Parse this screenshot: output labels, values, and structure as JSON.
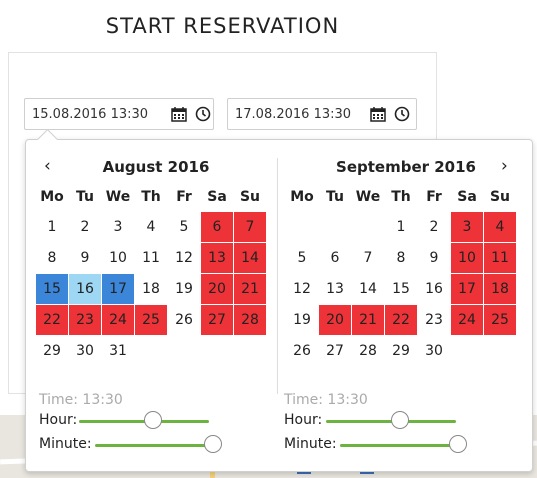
{
  "title": "START RESERVATION",
  "inputs": {
    "start": "15.08.2016 13:30",
    "end": "17.08.2016 13:30"
  },
  "weekdays": [
    "Mo",
    "Tu",
    "We",
    "Th",
    "Fr",
    "Sa",
    "Su"
  ],
  "nav": {
    "prev": "‹",
    "next": "›"
  },
  "calendars": [
    {
      "month": "August 2016",
      "weeks": [
        [
          {
            "d": "1",
            "s": "muted"
          },
          {
            "d": "2",
            "s": "muted"
          },
          {
            "d": "3",
            "s": ""
          },
          {
            "d": "4",
            "s": ""
          },
          {
            "d": "5",
            "s": ""
          },
          {
            "d": "6",
            "s": "red"
          },
          {
            "d": "7",
            "s": "red"
          }
        ],
        [
          {
            "d": "8",
            "s": ""
          },
          {
            "d": "9",
            "s": ""
          },
          {
            "d": "10",
            "s": ""
          },
          {
            "d": "11",
            "s": ""
          },
          {
            "d": "12",
            "s": ""
          },
          {
            "d": "13",
            "s": "red"
          },
          {
            "d": "14",
            "s": "red"
          }
        ],
        [
          {
            "d": "15",
            "s": "sel"
          },
          {
            "d": "16",
            "s": "light"
          },
          {
            "d": "17",
            "s": "sel"
          },
          {
            "d": "18",
            "s": ""
          },
          {
            "d": "19",
            "s": ""
          },
          {
            "d": "20",
            "s": "red"
          },
          {
            "d": "21",
            "s": "red"
          }
        ],
        [
          {
            "d": "22",
            "s": "red"
          },
          {
            "d": "23",
            "s": "red"
          },
          {
            "d": "24",
            "s": "red"
          },
          {
            "d": "25",
            "s": "red"
          },
          {
            "d": "26",
            "s": ""
          },
          {
            "d": "27",
            "s": "red"
          },
          {
            "d": "28",
            "s": "red"
          }
        ],
        [
          {
            "d": "29",
            "s": ""
          },
          {
            "d": "30",
            "s": ""
          },
          {
            "d": "31",
            "s": ""
          },
          {
            "d": "",
            "s": ""
          },
          {
            "d": "",
            "s": ""
          },
          {
            "d": "",
            "s": ""
          },
          {
            "d": "",
            "s": ""
          }
        ]
      ],
      "time": "Time: 13:30",
      "hour_label": "Hour:",
      "minute_label": "Minute:",
      "hour_level": 0.57,
      "minute_level": 1.0
    },
    {
      "month": "September 2016",
      "weeks": [
        [
          {
            "d": "",
            "s": ""
          },
          {
            "d": "",
            "s": ""
          },
          {
            "d": "",
            "s": ""
          },
          {
            "d": "1",
            "s": ""
          },
          {
            "d": "2",
            "s": ""
          },
          {
            "d": "3",
            "s": "red"
          },
          {
            "d": "4",
            "s": "red"
          }
        ],
        [
          {
            "d": "5",
            "s": ""
          },
          {
            "d": "6",
            "s": ""
          },
          {
            "d": "7",
            "s": ""
          },
          {
            "d": "8",
            "s": ""
          },
          {
            "d": "9",
            "s": ""
          },
          {
            "d": "10",
            "s": "red"
          },
          {
            "d": "11",
            "s": "red"
          }
        ],
        [
          {
            "d": "12",
            "s": ""
          },
          {
            "d": "13",
            "s": ""
          },
          {
            "d": "14",
            "s": ""
          },
          {
            "d": "15",
            "s": ""
          },
          {
            "d": "16",
            "s": ""
          },
          {
            "d": "17",
            "s": "red"
          },
          {
            "d": "18",
            "s": "red"
          }
        ],
        [
          {
            "d": "19",
            "s": ""
          },
          {
            "d": "20",
            "s": "red"
          },
          {
            "d": "21",
            "s": "red"
          },
          {
            "d": "22",
            "s": "red"
          },
          {
            "d": "23",
            "s": ""
          },
          {
            "d": "24",
            "s": "red"
          },
          {
            "d": "25",
            "s": "red"
          }
        ],
        [
          {
            "d": "26",
            "s": ""
          },
          {
            "d": "27",
            "s": ""
          },
          {
            "d": "28",
            "s": ""
          },
          {
            "d": "29",
            "s": ""
          },
          {
            "d": "30",
            "s": ""
          },
          {
            "d": "",
            "s": ""
          },
          {
            "d": "",
            "s": ""
          }
        ]
      ],
      "time": "Time: 13:30",
      "hour_label": "Hour:",
      "minute_label": "Minute:",
      "hour_level": 0.57,
      "minute_level": 1.0
    }
  ],
  "icons": {
    "calendar": "calendar-icon",
    "clock": "clock-icon"
  },
  "colors": {
    "booked": "#ee3338",
    "selected": "#3b86d8",
    "range": "#9ed7f4",
    "slider": "#6db33f"
  }
}
